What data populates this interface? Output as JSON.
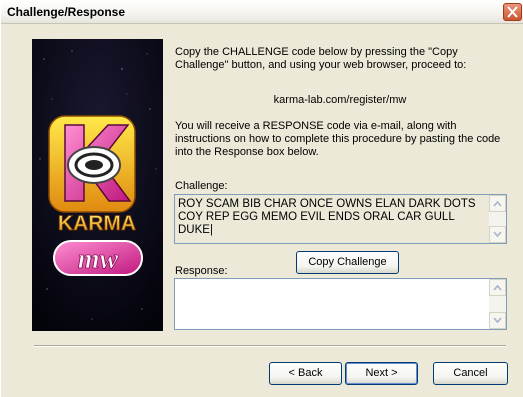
{
  "window": {
    "title": "Challenge/Response"
  },
  "logo": {
    "wordmark": "KARMA",
    "submark": "mw"
  },
  "instructions": {
    "paragraph1": "Copy the CHALLENGE code below by pressing the \"Copy Challenge\" button, and using your web browser, proceed to:",
    "url": "karma-lab.com/register/mw",
    "paragraph2": "You will receive a RESPONSE code via e-mail, along with instructions on how to complete this procedure by pasting the code into the Response box below."
  },
  "challenge": {
    "label": "Challenge:",
    "line1": "ROY SCAM BIB CHAR ONCE OWNS ELAN DARK DOTS",
    "line2": "COY REP EGG MEMO EVIL ENDS ORAL CAR GULL DUKE|"
  },
  "copy_button": {
    "label": "Copy Challenge"
  },
  "response": {
    "label": "Response:",
    "value": ""
  },
  "footer": {
    "back_label": "< Back",
    "next_label": "Next >",
    "cancel_label": "Cancel"
  },
  "colors": {
    "dialog_bg": "#ece9d8",
    "close_button": "#c9552f",
    "field_border": "#7f9db9",
    "default_button_border": "#003c74"
  },
  "icons": [
    "close-icon",
    "scroll-up-arrow-icon",
    "scroll-down-arrow-icon",
    "karma-logo"
  ]
}
